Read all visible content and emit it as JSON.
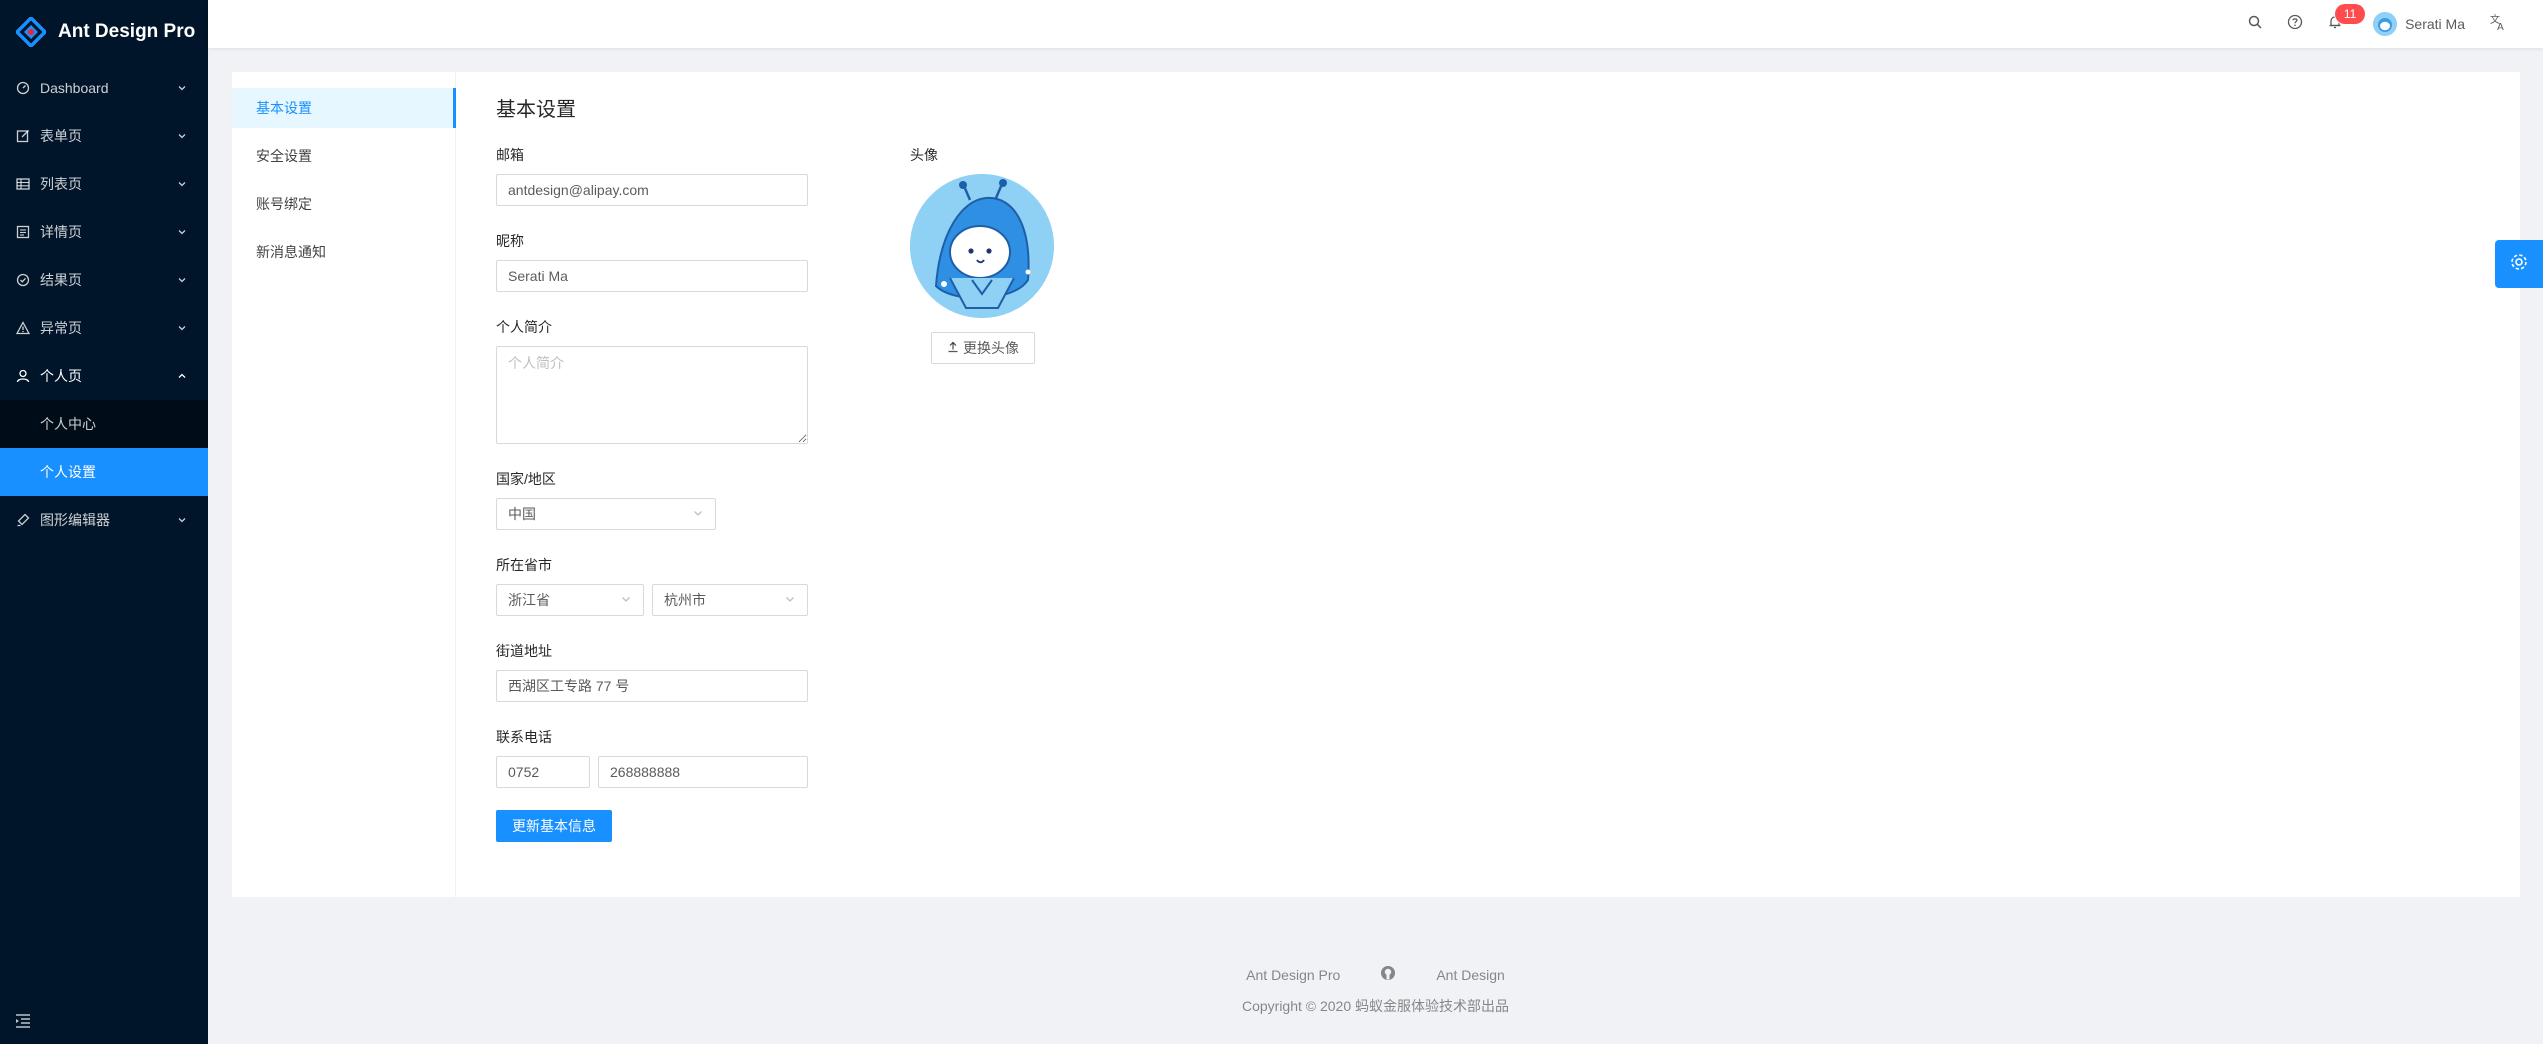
{
  "app": {
    "title": "Ant Design Pro"
  },
  "sidebar": {
    "items": [
      {
        "label": "Dashboard",
        "icon": "dashboard-icon"
      },
      {
        "label": "表单页",
        "icon": "form-icon"
      },
      {
        "label": "列表页",
        "icon": "table-icon"
      },
      {
        "label": "详情页",
        "icon": "profile-icon"
      },
      {
        "label": "结果页",
        "icon": "check-circle-icon"
      },
      {
        "label": "异常页",
        "icon": "warning-icon"
      },
      {
        "label": "个人页",
        "icon": "user-icon"
      },
      {
        "label": "图形编辑器",
        "icon": "highlight-icon"
      }
    ],
    "sub_items": [
      {
        "label": "个人中心"
      },
      {
        "label": "个人设置"
      }
    ]
  },
  "header": {
    "notification_count": "11",
    "user_name": "Serati Ma"
  },
  "settings_menu": {
    "items": [
      {
        "label": "基本设置"
      },
      {
        "label": "安全设置"
      },
      {
        "label": "账号绑定"
      },
      {
        "label": "新消息通知"
      }
    ]
  },
  "form": {
    "title": "基本设置",
    "email_label": "邮箱",
    "email_value": "antdesign@alipay.com",
    "nickname_label": "昵称",
    "nickname_value": "Serati Ma",
    "bio_label": "个人简介",
    "bio_placeholder": "个人简介",
    "country_label": "国家/地区",
    "country_value": "中国",
    "province_label": "所在省市",
    "province_value": "浙江省",
    "city_value": "杭州市",
    "address_label": "街道地址",
    "address_value": "西湖区工专路 77 号",
    "phone_label": "联系电话",
    "phone_area": "0752",
    "phone_number": "268888888",
    "submit_label": "更新基本信息"
  },
  "avatar": {
    "label": "头像",
    "change_label": "更换头像"
  },
  "footer": {
    "link1": "Ant Design Pro",
    "link3": "Ant Design",
    "copyright": "Copyright © 2020 蚂蚁金服体验技术部出品"
  },
  "colors": {
    "primary": "#1890ff",
    "sider_bg": "#001529",
    "badge": "#ff4d4f"
  }
}
